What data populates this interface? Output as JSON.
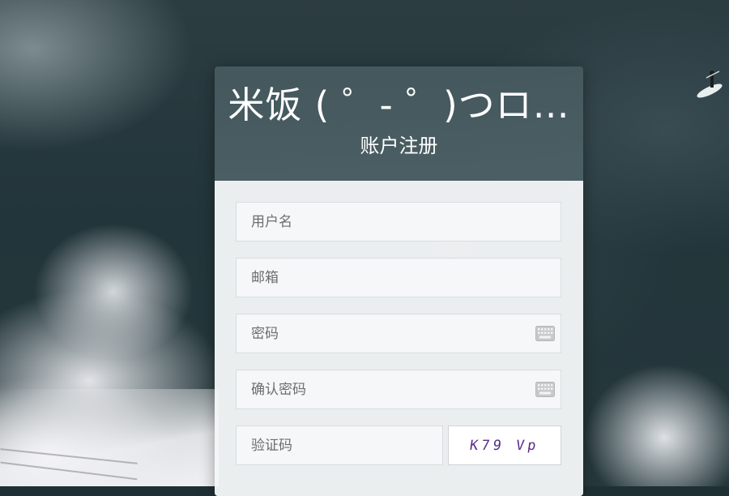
{
  "header": {
    "site_name": "米饭 ( ゜- ゜)つロ…",
    "form_title": "账户注册"
  },
  "form": {
    "username_placeholder": "用户名",
    "email_placeholder": "邮箱",
    "password_placeholder": "密码",
    "confirm_password_placeholder": "确认密码",
    "captcha_placeholder": "验证码",
    "captcha_text": "K79 Vp"
  },
  "colors": {
    "card_header": "#4e6268",
    "card_body": "#f4f6f7",
    "field_border": "#d9dde0"
  }
}
